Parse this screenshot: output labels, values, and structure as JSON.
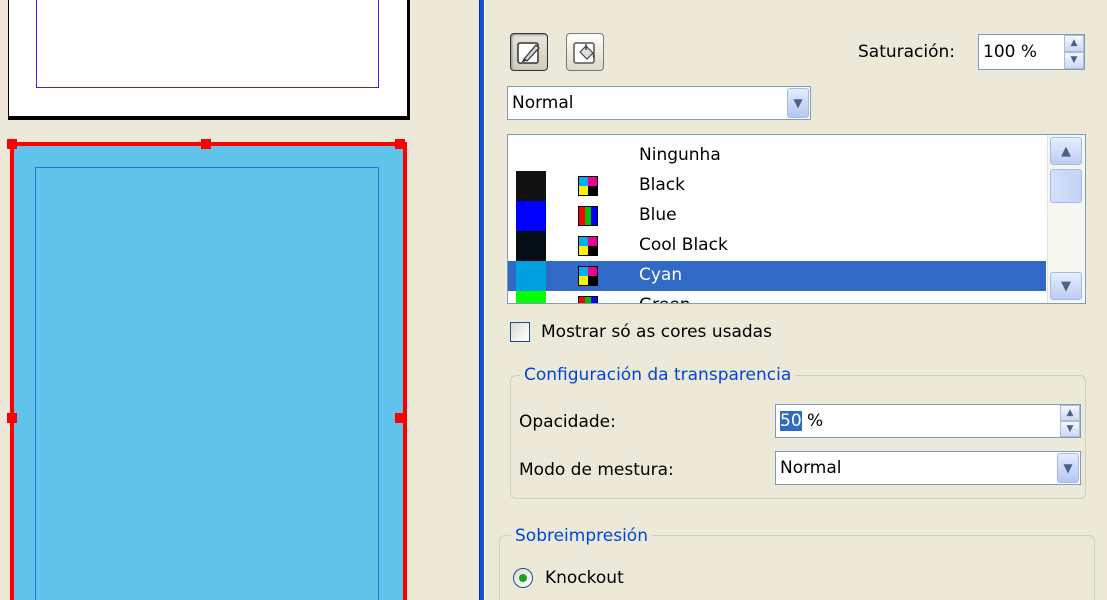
{
  "panel": {
    "tool_buttons": [
      {
        "icon": "brush-icon",
        "pressed": true
      },
      {
        "icon": "paint-bucket-icon",
        "pressed": false
      }
    ],
    "saturation": {
      "label": "Saturación:",
      "value": "100 %"
    },
    "tone_mode": {
      "value": "Normal"
    },
    "color_list": {
      "items": [
        {
          "name": "Ningunha",
          "swatch": null,
          "model": null
        },
        {
          "name": "Black",
          "swatch": "#111111",
          "model": "cmyk"
        },
        {
          "name": "Blue",
          "swatch": "#0000ff",
          "model": "rgb"
        },
        {
          "name": "Cool Black",
          "swatch": "#050d14",
          "model": "cmyk"
        },
        {
          "name": "Cyan",
          "swatch": "#00a0e0",
          "model": "cmyk",
          "selected": true
        },
        {
          "name": "Green",
          "swatch": "#00ff00",
          "model": "rgb"
        }
      ]
    },
    "show_used_colors": {
      "label": "Mostrar só as cores usadas",
      "checked": false
    },
    "transparency": {
      "title": "Configuración da transparencia",
      "opacity": {
        "label": "Opacidade:",
        "value_selected": "50",
        "unit": " %"
      },
      "blend_mode": {
        "label": "Modo de mestura:",
        "value": "Normal"
      }
    },
    "overprint": {
      "title": "Sobreimpresión",
      "knockout": {
        "label": "Knockout",
        "checked": true
      }
    }
  },
  "colors": {
    "selection": "#316ac5",
    "frame_fill": "#62c3ea",
    "frame_border": "#ff0000",
    "panel_accent": "#1a4fd6",
    "group_title": "#0046d5"
  }
}
